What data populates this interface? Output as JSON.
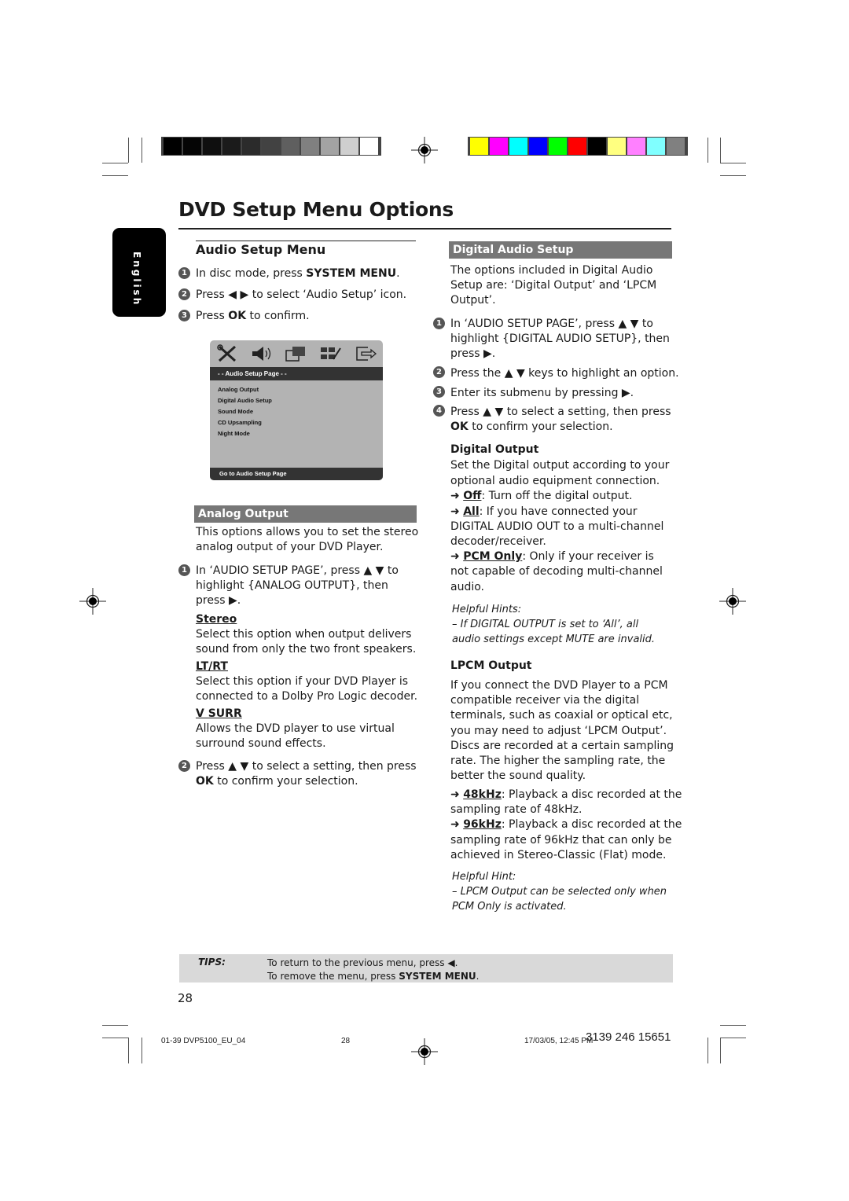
{
  "color_bars": {
    "grayscale": [
      "#000000",
      "#050505",
      "#0f0f0f",
      "#1b1b1b",
      "#2b2b2b",
      "#424242",
      "#5f5f5f",
      "#808080",
      "#a3a3a3",
      "#cfcfcf",
      "#ffffff"
    ],
    "colors": [
      "#ffff00",
      "#ff00ff",
      "#00ffff",
      "#0000ff",
      "#00ff00",
      "#ff0000",
      "#000000",
      "#ffff80",
      "#ff80ff",
      "#80ffff",
      "#808080"
    ]
  },
  "page": {
    "title": "DVD Setup Menu Options",
    "language_tab": "English",
    "page_number": "28"
  },
  "audio_setup_menu": {
    "heading": "Audio Setup Menu",
    "steps": [
      {
        "num": "1",
        "pre": "In disc mode, press ",
        "bold": "SYSTEM MENU",
        "post": "."
      },
      {
        "num": "2",
        "text": "Press ◀ ▶ to select ‘Audio Setup’ icon."
      },
      {
        "num": "3",
        "pre": "Press ",
        "bold": "OK",
        "post": " to confirm."
      }
    ]
  },
  "osd_menu": {
    "icons": [
      "tools-icon",
      "speaker-icon",
      "video-icon",
      "preference-icon",
      "exit-icon"
    ],
    "header": "- -   Audio Setup Page   - -",
    "items": [
      "Analog Output",
      "Digital Audio Setup",
      "Sound Mode",
      "CD Upsampling",
      "Night Mode"
    ],
    "footer": "Go to Audio Setup Page"
  },
  "analog_output": {
    "heading": "Analog Output",
    "intro": [
      "This options allows you to set the stereo",
      "analog output of your DVD Player."
    ],
    "step1": {
      "num": "1",
      "lines": [
        "In ‘AUDIO SETUP PAGE’, press ▲ ▼ to",
        "highlight {ANALOG OUTPUT}, then",
        "press ▶."
      ]
    },
    "options": [
      {
        "name": "Stereo",
        "lines": [
          "Select this option when output delivers",
          "sound from only the two front speakers."
        ]
      },
      {
        "name": "LT/RT",
        "lines": [
          "Select this option if your DVD Player is",
          "connected to a Dolby Pro Logic decoder."
        ]
      },
      {
        "name": "V SURR",
        "lines": [
          "Allows the DVD player to use virtual",
          "surround sound effects."
        ]
      }
    ],
    "step2": {
      "num": "2",
      "line1": "Press ▲ ▼ to select a setting, then press",
      "bold": "OK",
      "line2": " to confirm your selection."
    }
  },
  "digital_audio_setup": {
    "heading": "Digital Audio Setup",
    "intro": [
      "The options included in Digital Audio",
      "Setup are: ‘Digital Output’ and ‘LPCM",
      "Output’."
    ],
    "steps": [
      {
        "num": "1",
        "lines": [
          "In ‘AUDIO SETUP PAGE’, press ▲ ▼ to",
          "highlight {DIGITAL AUDIO SETUP}, then",
          "press ▶."
        ]
      },
      {
        "num": "2",
        "lines": [
          "Press the ▲ ▼ keys to highlight an option."
        ]
      },
      {
        "num": "3",
        "lines": [
          "Enter its submenu by pressing ▶."
        ]
      },
      {
        "num": "4",
        "line1": "Press ▲ ▼ to select a setting, then press",
        "bold": "OK",
        "line2": " to confirm your selection."
      }
    ],
    "digital_output": {
      "heading": "Digital Output",
      "intro": [
        "Set the Digital output according to your",
        "optional audio equipment connection."
      ],
      "options": [
        {
          "name": "Off",
          "sep": ": ",
          "lines": [
            "Turn off the digital output."
          ]
        },
        {
          "name": "All",
          "sep": ": ",
          "lines": [
            "If you have connected your",
            "DIGITAL AUDIO OUT to a multi-channel",
            "decoder/receiver."
          ]
        },
        {
          "name": "PCM Only",
          "sep": ": ",
          "lines": [
            "Only if your receiver is",
            "not capable of decoding multi-channel",
            "audio."
          ]
        }
      ],
      "hint_title": "Helpful Hints:",
      "hint_lines": [
        "–    If DIGITAL OUTPUT is set to ‘All’, all",
        "audio settings except MUTE are invalid."
      ]
    },
    "lpcm_output": {
      "heading": "LPCM Output",
      "intro": [
        "If you connect the DVD Player to a PCM",
        "compatible receiver via the digital",
        "terminals, such as coaxial or optical etc,",
        "you may need to adjust ‘LPCM Output’.",
        "Discs are recorded at a certain sampling",
        "rate. The higher the sampling rate, the",
        "better the sound quality."
      ],
      "options": [
        {
          "name": "48kHz",
          "sep": ": ",
          "lines": [
            "Playback a disc recorded at the",
            "sampling rate of 48kHz."
          ]
        },
        {
          "name": "96kHz",
          "sep": ": ",
          "lines": [
            "Playback a disc recorded at the",
            "sampling rate of 96kHz that can only be",
            "achieved in Stereo-Classic (Flat) mode."
          ]
        }
      ],
      "hint_title": "Helpful Hint:",
      "hint_lines": [
        "–    LPCM Output can be selected only when",
        "PCM Only is activated."
      ]
    }
  },
  "tips": {
    "label": "TIPS:",
    "line1": "To return to the previous menu, press ◀.",
    "line2_pre": "To remove the menu, press ",
    "line2_bold": "SYSTEM MENU",
    "line2_post": "."
  },
  "footer": {
    "file": "01-39 DVP5100_EU_04",
    "page": "28",
    "timestamp": "17/03/05, 12:45 PM",
    "code": "3139 246 15651"
  },
  "arrow_glyph": "➜"
}
